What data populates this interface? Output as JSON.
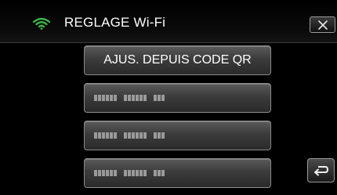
{
  "header": {
    "title": "REGLAGE Wi-Fi",
    "status_icon": "wifi-signal-icon",
    "close_icon": "close-icon",
    "accent_color": "#3cb54a"
  },
  "menu": {
    "items": [
      {
        "label": "AJUS. DEPUIS CODE QR"
      },
      {
        "label": "",
        "icon": "pixelated-placeholder-text"
      },
      {
        "label": "",
        "icon": "pixelated-placeholder-text"
      },
      {
        "label": "",
        "icon": "pixelated-placeholder-text"
      }
    ]
  },
  "footer": {
    "back_icon": "return-arrow-icon"
  }
}
